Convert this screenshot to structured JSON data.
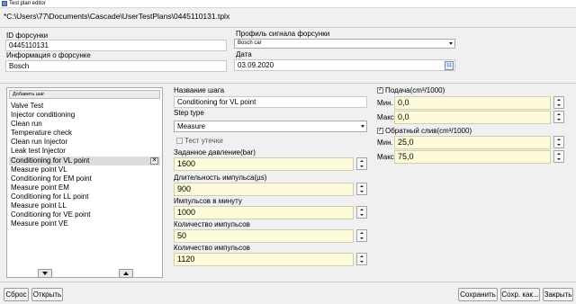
{
  "window": {
    "title": "Test plan editor",
    "path": "*C:\\Users\\77\\Documents\\Cascade\\UserTestPlans\\0445110131.tplx"
  },
  "injector": {
    "id_label": "ID форсунки",
    "id_value": "0445110131",
    "info_label": "Информация о форсунке",
    "info_value": "Bosch",
    "profile_label": "Профиль сигнала форсунки",
    "profile_value": "Bosch car",
    "date_label": "Дата",
    "date_value": "03.09.2020",
    "calendar_icon_text": "11"
  },
  "steps": {
    "add_step": "Добавить шаг",
    "items": [
      {
        "label": "Valve Test"
      },
      {
        "label": "Injector conditioning"
      },
      {
        "label": "Clean run"
      },
      {
        "label": "Temperature check"
      },
      {
        "label": "Clean run Injector"
      },
      {
        "label": "Leak test Injector"
      },
      {
        "label": "Conditioning  for VL point"
      },
      {
        "label": "Measure point VL"
      },
      {
        "label": "Conditioning  for EM point"
      },
      {
        "label": " Measure point EM"
      },
      {
        "label": "Conditioning  for LL  point"
      },
      {
        "label": "Measure point LL"
      },
      {
        "label": "Conditioning  for VE  point"
      },
      {
        "label": "Measure point VE"
      }
    ],
    "selected_index": 6,
    "delete_glyph": "✕"
  },
  "step_details": {
    "name_label": "Название шага",
    "name_value": "Conditioning  for VL point",
    "type_label": "Step type",
    "type_value": "Measure",
    "leak_test_label": "Тест утечки",
    "pressure_label": "Заданное давление(bar)",
    "pressure_value": "1600",
    "duration_label": "Длительность импульса(µs)",
    "duration_value": "900",
    "per_minute_label": "Импульсов в минуту",
    "per_minute_value": "1000",
    "count1_label": "Количество импульсов",
    "count1_value": "50",
    "count2_label": "Количество импульсов",
    "count2_value": "1120"
  },
  "delivery": {
    "label": "Подача(cm³/1000)",
    "checked": true,
    "min_label": "Мин.",
    "min_value": "0,0",
    "max_label": "Макс.",
    "max_value": "0,0"
  },
  "backflow": {
    "label": "Обратный слив(cm³/1000)",
    "checked": true,
    "min_label": "Мин.",
    "min_value": "25,0",
    "max_label": "Макс.",
    "max_value": "75,0"
  },
  "footer": {
    "reset": "Сброс",
    "open": "Открыть",
    "save": "Сохранить",
    "save_as": "Сохр. как...",
    "close": "Закрыть"
  },
  "colors": {
    "input_highlight": "#fdfbd9",
    "selected_row": "#dcdcdc"
  }
}
